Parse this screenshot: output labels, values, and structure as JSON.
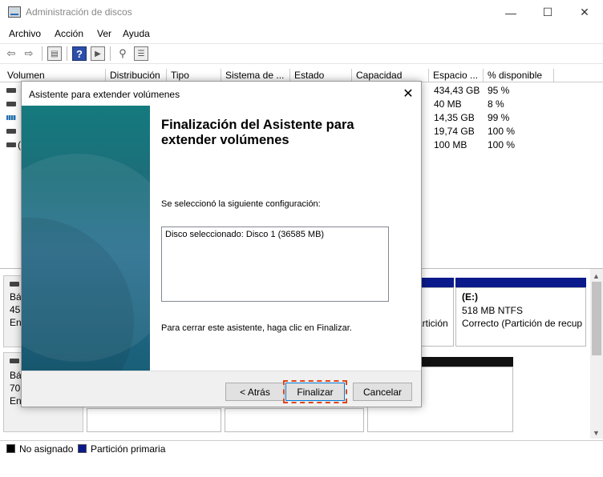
{
  "window": {
    "title": "Administración de discos",
    "minimize": "—",
    "maximize": "☐",
    "close": "✕"
  },
  "menu": [
    "Archivo",
    "Acción",
    "Ver",
    "Ayuda"
  ],
  "columns": [
    "Volumen",
    "Distribución",
    "Tipo",
    "Sistema de ...",
    "Estado",
    "Capacidad",
    "Espacio ...",
    "% disponible"
  ],
  "rows": [
    {
      "free": "434,43 GB",
      "pct": "95 %"
    },
    {
      "free": "40 MB",
      "pct": "8 %"
    },
    {
      "free": "14,35 GB",
      "pct": "99 %"
    },
    {
      "free": "19,74 GB",
      "pct": "100 %"
    },
    {
      "free": "100 MB",
      "pct": "100 %"
    }
  ],
  "row5_partial": "(",
  "disks": [
    {
      "label_line1": "Bá",
      "label_line2": "45",
      "label_line3": "En"
    },
    {
      "label_line1": "Bá",
      "label_line2": "70,",
      "label_line3": "En"
    }
  ],
  "partitions": {
    "partial_text": "artición",
    "e_title": "(E:)",
    "e_size": "518 MB NTFS",
    "e_status": "Correcto (Partición de recup"
  },
  "legend": [
    {
      "label": "No asignado",
      "color": "#000000"
    },
    {
      "label": "Partición primaria",
      "color": "#0a1a8a"
    }
  ],
  "dialog": {
    "title": "Asistente para extender volúmenes",
    "heading": "Finalización del Asistente para extender volúmenes",
    "intro": "Se seleccionó la siguiente configuración:",
    "config": "Disco seleccionado: Disco 1 (36585 MB)",
    "closing": "Para cerrar este asistente, haga clic en Finalizar.",
    "back_label": "< Atrás",
    "finish_label": "Finalizar",
    "cancel_label": "Cancelar"
  }
}
